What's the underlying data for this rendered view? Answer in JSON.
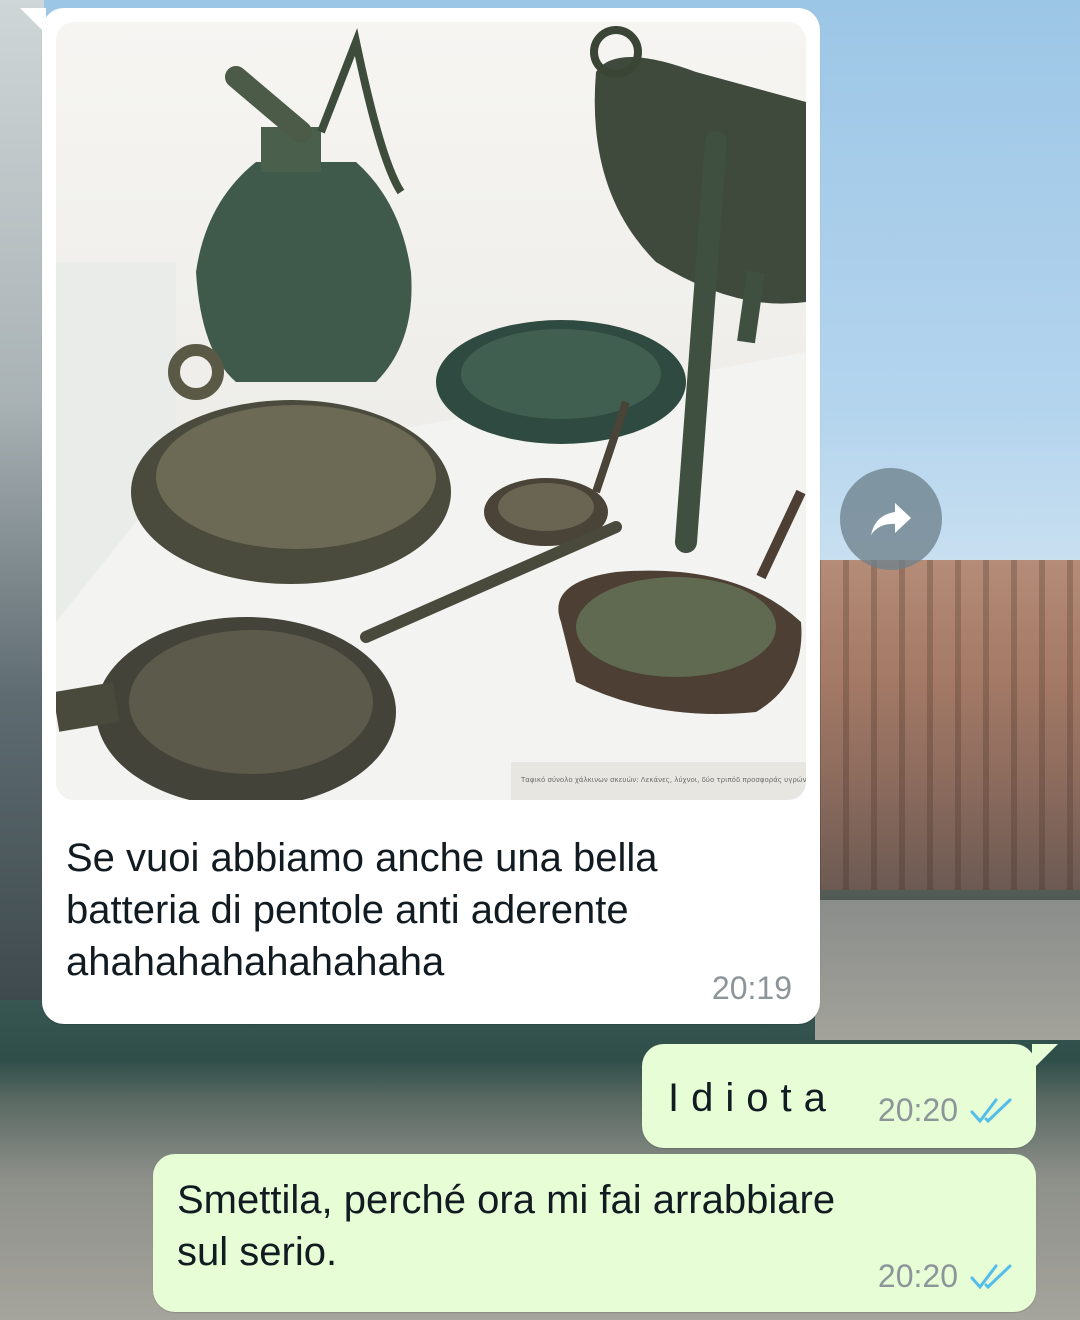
{
  "wallpaper": {
    "description_icon": "venice-canal-wallpaper"
  },
  "incoming": {
    "image_alt_icon": "museum-bronze-vessels-photo",
    "image_caption": "Ταφικό σύνολο χάλκινων σκευών: Λεκάνες, λύχνοι, δύο τριπόδ προσφοράς υγρών, όπως πρόχους, υδρία και αρύταινα (κουτάλ",
    "text_line1": "Se vuoi abbiamo anche una bella",
    "text_line2": "batteria di pentole anti aderente",
    "text_line3": "ahahahahahahahaha",
    "time": "20:19"
  },
  "forward": {
    "icon": "forward-arrow-icon"
  },
  "outgoing": [
    {
      "text": "Idiota",
      "time": "20:20",
      "status_icon": "double-check-read-icon"
    },
    {
      "text_line1": "Smettila, perché ora mi fai arrabbiare",
      "text_line2": "sul serio.",
      "time": "20:20",
      "status_icon": "double-check-read-icon"
    }
  ],
  "colors": {
    "incoming_bubble": "#ffffff",
    "outgoing_bubble": "#e7fdd5",
    "read_check": "#53bdeb",
    "timestamp": "#8c9599",
    "text": "#111b21"
  }
}
